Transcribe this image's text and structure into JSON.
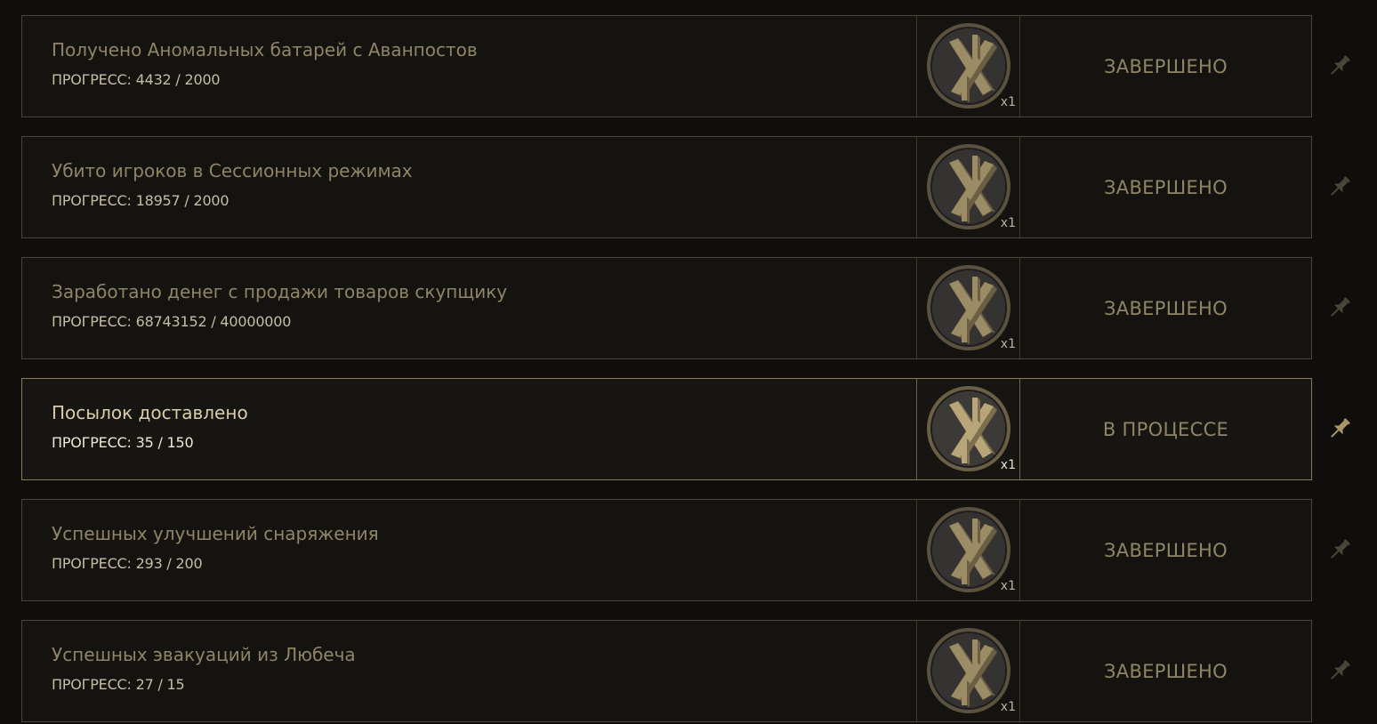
{
  "progress_label": "ПРОГРЕСС:",
  "colors": {
    "background": "#0f0e0c",
    "row_border": "#4a4536",
    "row_border_active": "#8a7b57",
    "title_muted": "#8f8566",
    "title_active": "#d9ccaa",
    "pin_muted": "#4a4536",
    "pin_active": "#a8966a"
  },
  "achievements": [
    {
      "title": "Получено Аномальных батарей с Аванпостов",
      "progress_current": "4432",
      "progress_target": "2000",
      "progress_text": "ПРОГРЕСС: 4432 / 2000",
      "reward_icon": "battle-pass-token-icon",
      "reward_qty": "x1",
      "status": "ЗАВЕРШЕНО",
      "pinned": false
    },
    {
      "title": "Убито игроков в Сессионных режимах",
      "progress_current": "18957",
      "progress_target": "2000",
      "progress_text": "ПРОГРЕСС: 18957 / 2000",
      "reward_icon": "battle-pass-token-icon",
      "reward_qty": "x1",
      "status": "ЗАВЕРШЕНО",
      "pinned": false
    },
    {
      "title": "Заработано денег с продажи товаров скупщику",
      "progress_current": "68743152",
      "progress_target": "40000000",
      "progress_text": "ПРОГРЕСС: 68743152 / 40000000",
      "reward_icon": "battle-pass-token-icon",
      "reward_qty": "x1",
      "status": "ЗАВЕРШЕНО",
      "pinned": false
    },
    {
      "title": "Посылок доставлено",
      "progress_current": "35",
      "progress_target": "150",
      "progress_text": "ПРОГРЕСС: 35 / 150",
      "reward_icon": "battle-pass-token-icon",
      "reward_qty": "x1",
      "status": "В ПРОЦЕССЕ",
      "pinned": true
    },
    {
      "title": "Успешных улучшений снаряжения",
      "progress_current": "293",
      "progress_target": "200",
      "progress_text": "ПРОГРЕСС: 293 / 200",
      "reward_icon": "battle-pass-token-icon",
      "reward_qty": "x1",
      "status": "ЗАВЕРШЕНО",
      "pinned": false
    },
    {
      "title": "Успешных эвакуаций из Любеча",
      "progress_current": "27",
      "progress_target": "15",
      "progress_text": "ПРОГРЕСС: 27 / 15",
      "reward_icon": "battle-pass-token-icon",
      "reward_qty": "x1",
      "status": "ЗАВЕРШЕНО",
      "pinned": false
    }
  ]
}
